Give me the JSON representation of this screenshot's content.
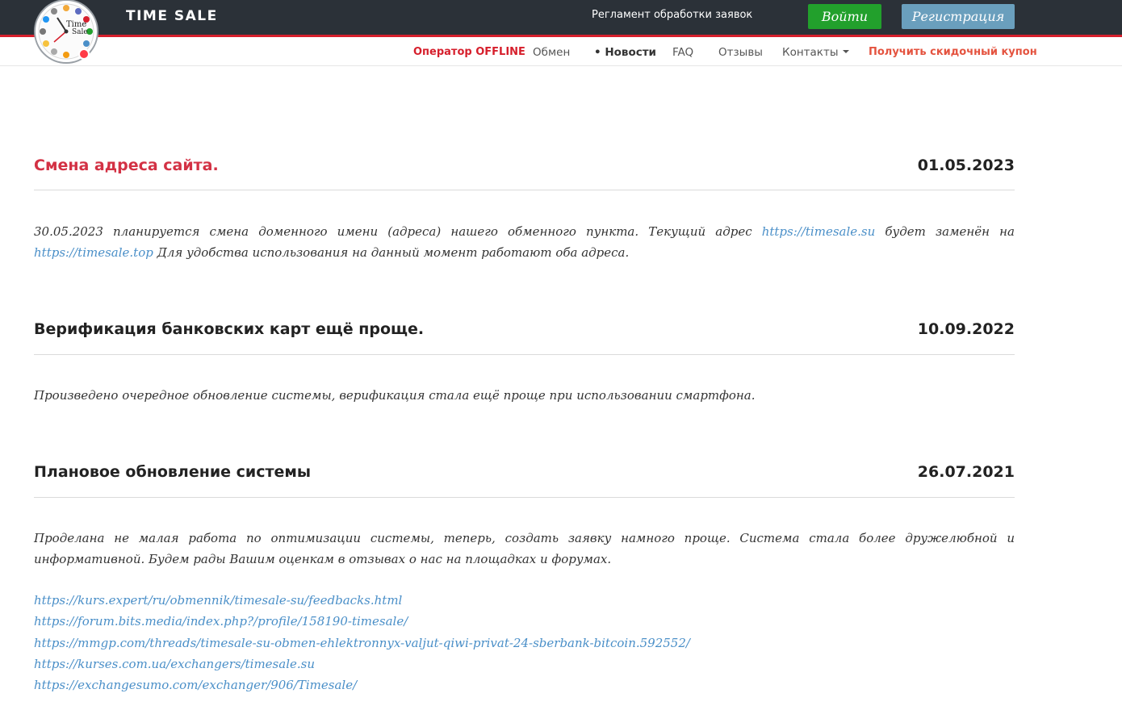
{
  "header": {
    "brand": "TIME SALE",
    "reglament_link": "Регламент обработки заявок",
    "login_button": "Войти",
    "register_button": "Регистрация",
    "logo_text_1": "Time",
    "logo_text_2": "Sale"
  },
  "nav": {
    "operator_status": "Оператор OFFLINE",
    "items": [
      "Обмен",
      "• Новости",
      "FAQ",
      "Отзывы",
      "Контакты"
    ],
    "coupon": "Получить скидочный купон"
  },
  "colors": {
    "topbar": "#2b3138",
    "accent_red": "#d61f2c",
    "login_green": "#22a02c",
    "register_blue": "#6a9fbd",
    "link": "#4a8fc8"
  },
  "news": [
    {
      "title": "Смена адреса сайта.",
      "date": "01.05.2023",
      "text_1": "30.05.2023 планируется смена доменного имени (адреса) нашего обменного пункта. Текущий адрес ",
      "link_1": "https://timesale.su",
      "text_2": " будет заменён на ",
      "link_2": "https://timesale.top",
      "text_3": " Для удобства использования на данный момент работают оба адреса."
    },
    {
      "title": "Верификация банковских карт ещё проще.",
      "date": "10.09.2022",
      "text": "Произведено очередное обновление системы, верификация стала ещё проще при использовании смартфона."
    },
    {
      "title": "Плановое обновление системы",
      "date": "26.07.2021",
      "text": "Проделана не малая работа по оптимизации системы, теперь, создать заявку намного проще. Система стала более дружелюбной и информативной. Будем рады Вашим оценкам в отзывах о нас на площадках и форумах.",
      "links": [
        "https://kurs.expert/ru/obmennik/timesale-su/feedbacks.html",
        "https://forum.bits.media/index.php?/profile/158190-timesale/",
        "https://mmgp.com/threads/timesale-su-obmen-ehlektronnyx-valjut-qiwi-privat-24-sberbank-bitcoin.592552/",
        "https://kurses.com.ua/exchangers/timesale.su",
        "https://exchangesumo.com/exchanger/906/Timesale/"
      ]
    }
  ]
}
